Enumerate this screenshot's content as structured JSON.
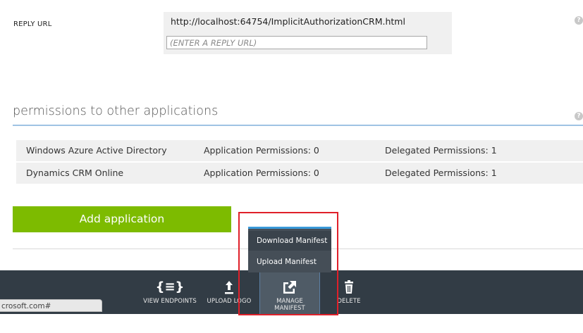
{
  "reply_url": {
    "label": "REPLY URL",
    "existing_value": "http://localhost:64754/ImplicitAuthorizationCRM.html",
    "input_placeholder": "(ENTER A REPLY URL)"
  },
  "permissions": {
    "title": "permissions to other applications",
    "rows": [
      {
        "app": "Windows Azure Active Directory",
        "application_permissions": "Application Permissions: 0",
        "delegated_permissions": "Delegated Permissions: 1"
      },
      {
        "app": "Dynamics CRM Online",
        "application_permissions": "Application Permissions: 0",
        "delegated_permissions": "Delegated Permissions: 1"
      }
    ],
    "add_button": "Add application"
  },
  "help_glyph": "?",
  "command_bar": {
    "view_endpoints": "VIEW ENDPOINTS",
    "upload_logo": "UPLOAD LOGO",
    "manage_manifest_line1": "MANAGE",
    "manage_manifest_line2": "MANIFEST",
    "delete": "DELETE",
    "icon_braces": "{≡}"
  },
  "manifest_menu": {
    "download": "Download Manifest",
    "upload": "Upload Manifest"
  },
  "status_bar": {
    "url_fragment": "crosoft.com#"
  },
  "colors": {
    "accent_green": "#7dbb00",
    "command_bar": "#323c45",
    "highlight_red": "#e0202a",
    "section_rule": "#9fc3e4"
  }
}
